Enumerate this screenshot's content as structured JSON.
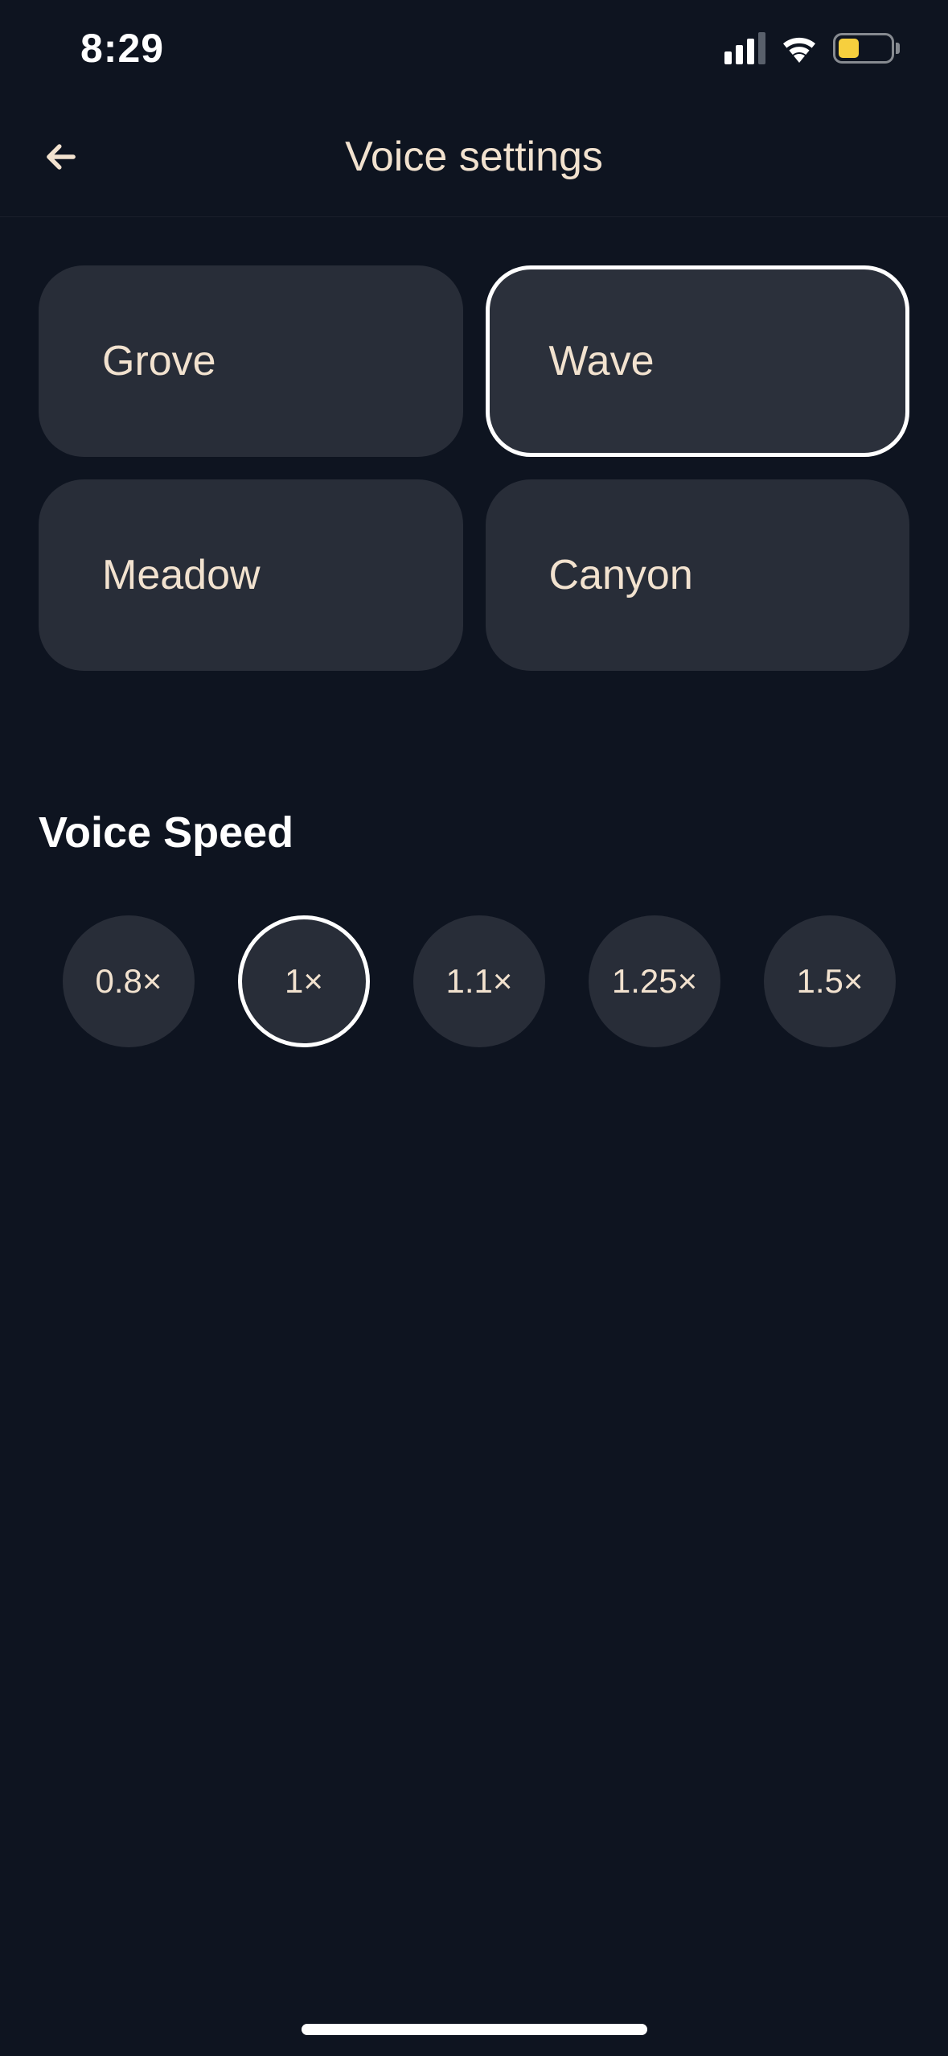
{
  "status_bar": {
    "time": "8:29"
  },
  "header": {
    "title": "Voice settings"
  },
  "voices": {
    "selected_index": 1,
    "options": [
      "Grove",
      "Wave",
      "Meadow",
      "Canyon"
    ]
  },
  "voice_speed": {
    "section_title": "Voice Speed",
    "selected_index": 1,
    "options": [
      "0.8×",
      "1×",
      "1.1×",
      "1.25×",
      "1.5×"
    ]
  }
}
